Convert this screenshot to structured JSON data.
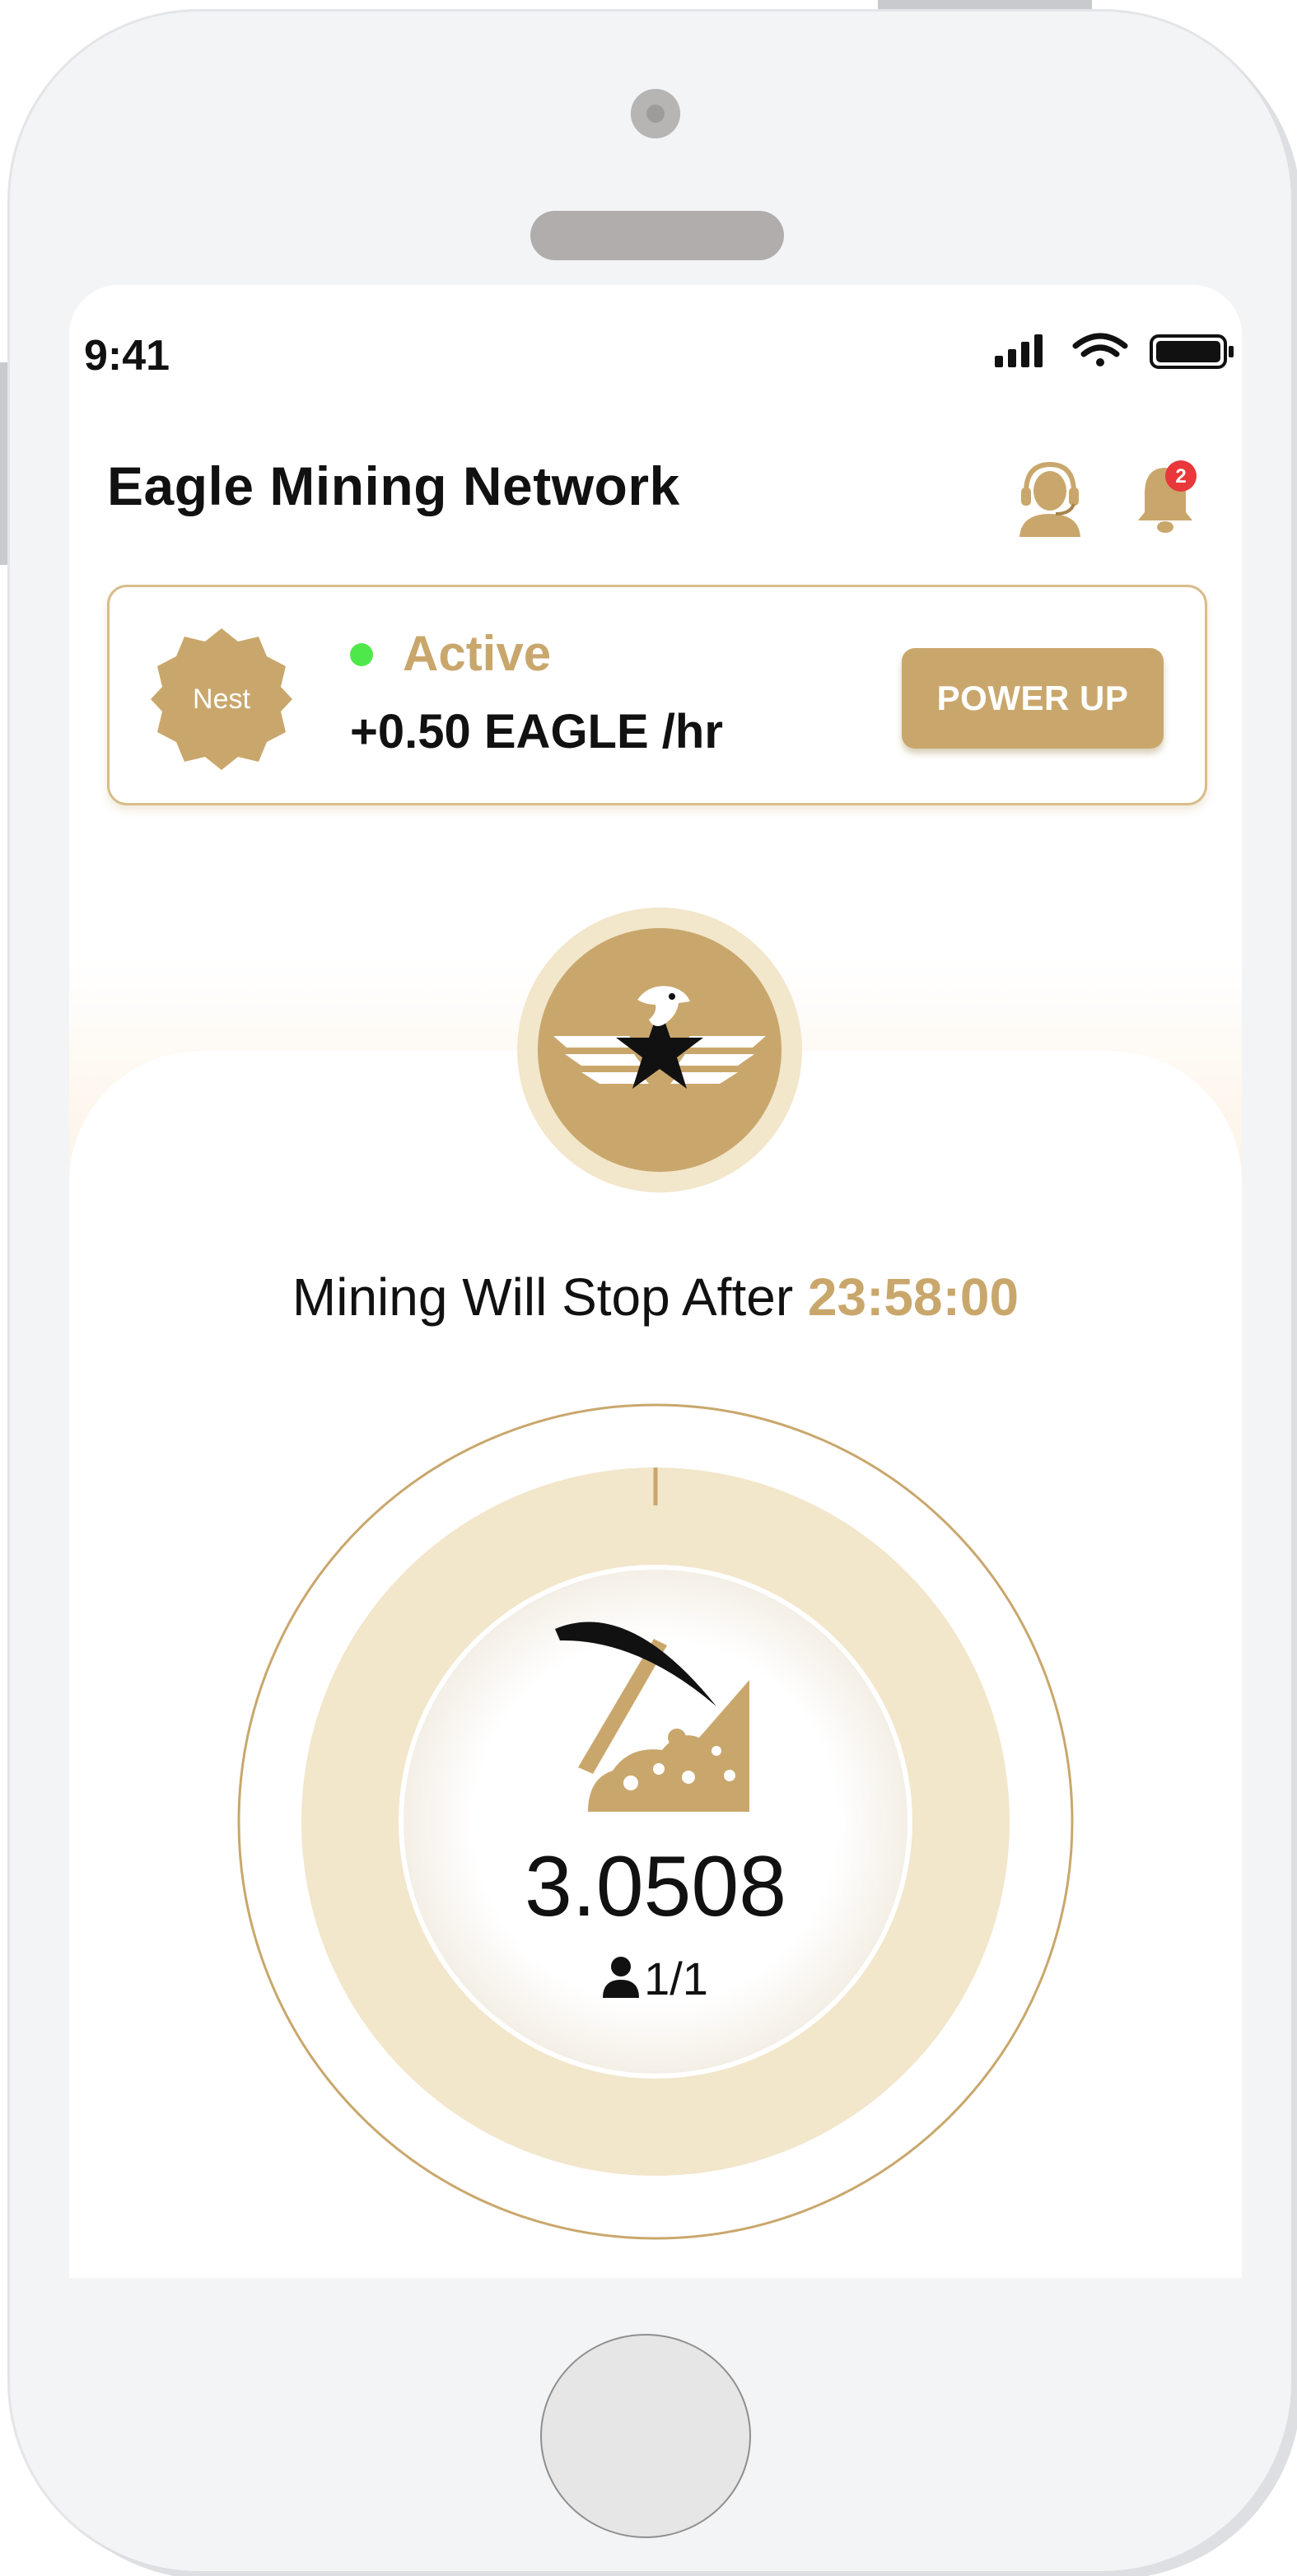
{
  "status_bar": {
    "time": "9:41"
  },
  "header": {
    "title": "Eagle Mining Network",
    "notification_count": "2"
  },
  "status_card": {
    "badge": "Nest",
    "status": "Active",
    "rate": "+0.50 EAGLE /hr",
    "power_up_label": "POWER UP"
  },
  "mining": {
    "stop_prefix": "Mining Will Stop After",
    "countdown": "23:58:00",
    "balance": "3.0508",
    "referrals": "1/1"
  },
  "colors": {
    "accent_gold": "#c9a76c",
    "ring_light": "#f2e6cb",
    "active_green": "#4fe84a",
    "notification_red": "#e8383b"
  },
  "icons": [
    "support-agent-icon",
    "bell-icon",
    "eagle-logo-icon",
    "pickaxe-icon",
    "user-icon",
    "signal-icon",
    "wifi-icon",
    "battery-icon"
  ]
}
